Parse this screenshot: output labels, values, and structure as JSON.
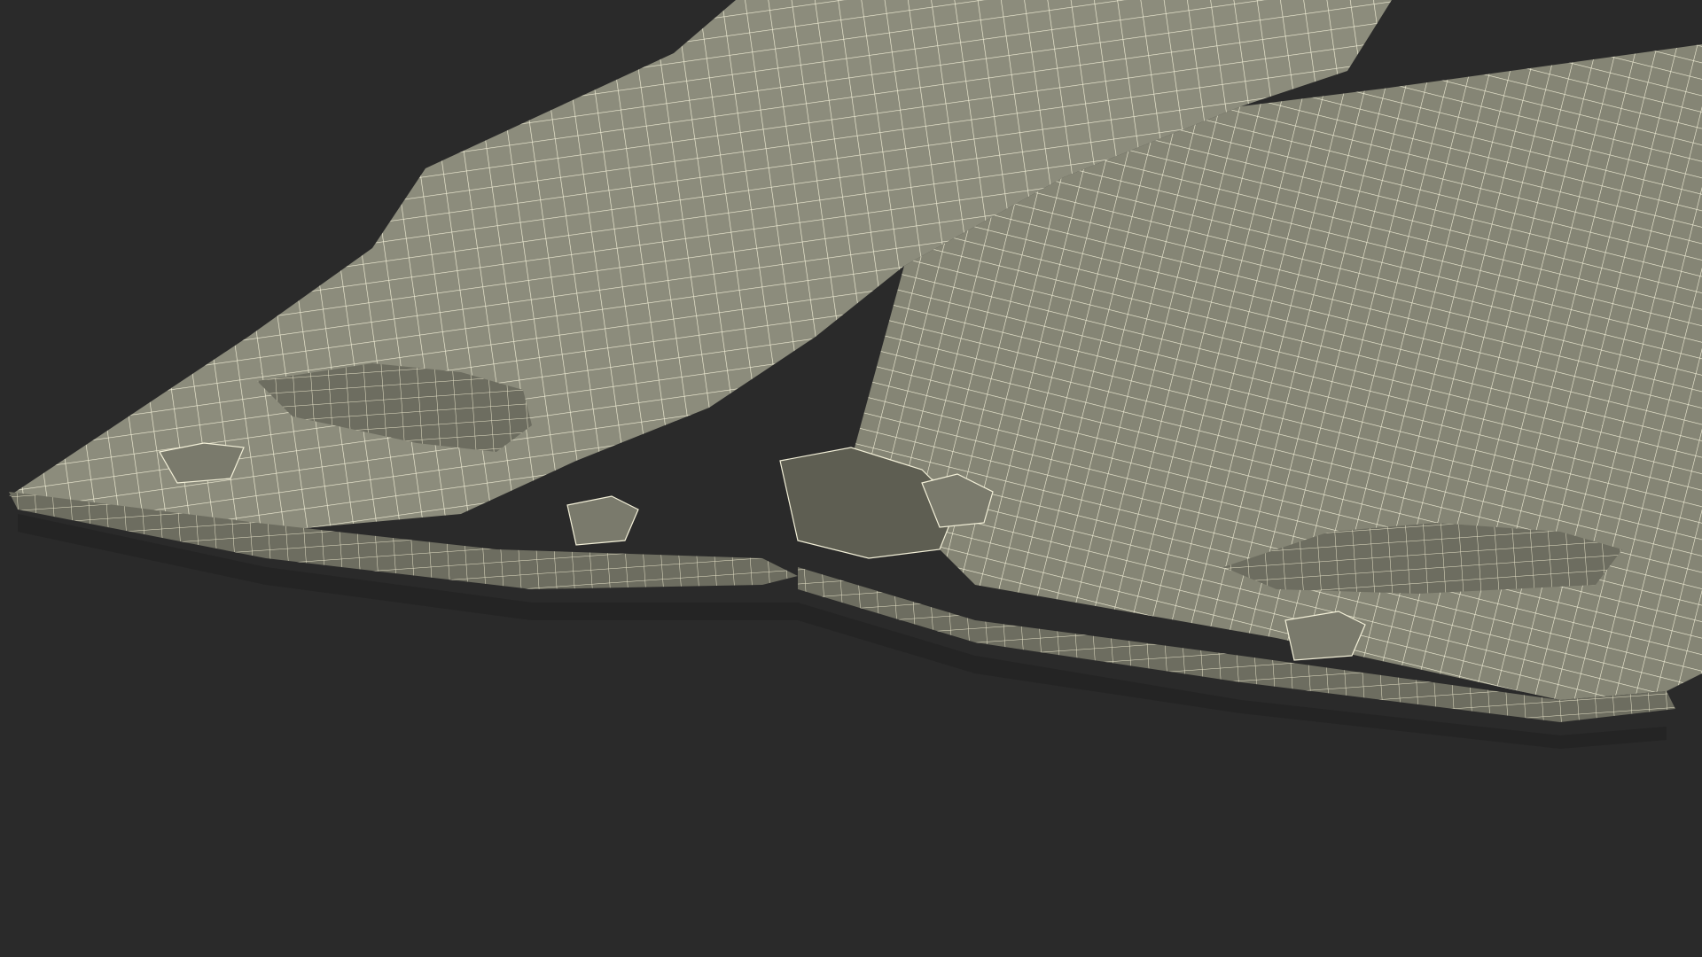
{
  "scene": {
    "background_color": "#2a2a2a",
    "mesh_color": "#8c8c7c",
    "mesh_shadow_color": "#5e5e52",
    "wire_color": "#f3f0d8",
    "subject": "wireframe-trousers-model"
  }
}
